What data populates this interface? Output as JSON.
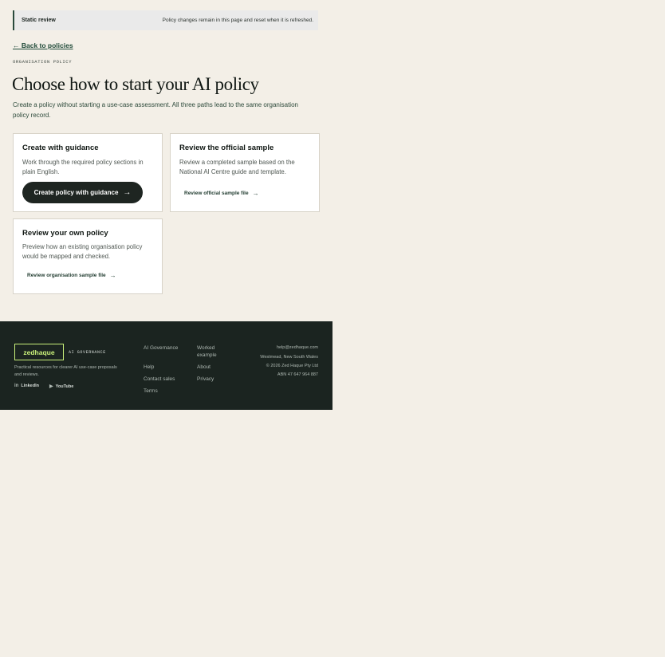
{
  "banner": {
    "label": "Static review",
    "note": "Policy changes remain in this page and reset when it is refreshed."
  },
  "back_link": "← Back to policies",
  "eyebrow": "ORGANISATION POLICY",
  "title": "Choose how to start your AI policy",
  "lede": "Create a policy without starting a use-case assessment. All three paths lead to the same organisation policy record.",
  "cards": [
    {
      "title": "Create with guidance",
      "body": "Work through the required policy sections in plain English.",
      "action": "Create policy with guidance",
      "action_arrow": "→"
    },
    {
      "title": "Review the official sample",
      "body": "Review a completed sample based on the National AI Centre guide and template.",
      "action": "Review official sample file",
      "action_arrow": "→"
    },
    {
      "title": "Review your own policy",
      "body": "Preview how an existing organisation policy would be mapped and checked.",
      "action": "Review organisation sample file",
      "action_arrow": "→"
    }
  ],
  "footer": {
    "logo": "zedhaque",
    "tagline": "AI GOVERNANCE",
    "description": "Practical resources for clearer AI use-case proposals and reviews.",
    "social": [
      {
        "icon": "linkedin-icon",
        "label": "LinkedIn"
      },
      {
        "icon": "youtube-icon",
        "label": "YouTube"
      }
    ],
    "links_col1": [
      "AI Governance",
      "Help",
      "Contact sales",
      "Terms"
    ],
    "links_col2": [
      "Worked example",
      "About",
      "Privacy"
    ],
    "contact": {
      "email": "help@zedhaque.com",
      "location": "Westmead, New South Wales",
      "copyright": "© 2026 Zed Haque Pty Ltd",
      "abn": "ABN 47 647 964 887"
    }
  },
  "colors": {
    "page_bg": "#f3efe7",
    "footer_bg": "#1b2420",
    "accent_green": "#1f4a38",
    "logo_lime": "#c9f07a",
    "primary_button": "#1e2521"
  }
}
